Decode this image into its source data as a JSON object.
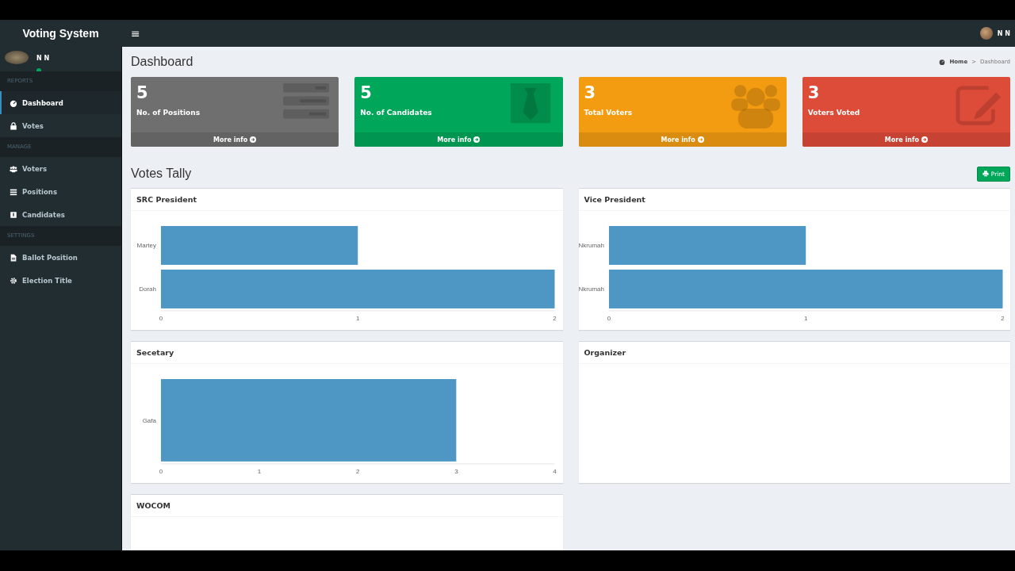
{
  "header": {
    "brand": "Voting System",
    "menu_glyph": "≡",
    "user": "N N"
  },
  "sidebar": {
    "user": "N N",
    "sections": [
      {
        "header": "REPORTS",
        "items": [
          {
            "label": "Dashboard",
            "kind": "dashboard",
            "selected": true
          },
          {
            "label": "Votes",
            "kind": "lock",
            "selected": false
          }
        ]
      },
      {
        "header": "MANAGE",
        "items": [
          {
            "label": "Voters",
            "kind": "users",
            "selected": false
          },
          {
            "label": "Positions",
            "kind": "list",
            "selected": false
          },
          {
            "label": "Candidates",
            "kind": "card",
            "selected": false
          }
        ]
      },
      {
        "header": "SETTINGS",
        "items": [
          {
            "label": "Ballot Position",
            "kind": "file",
            "selected": false
          },
          {
            "label": "Election Title",
            "kind": "gear",
            "selected": false
          }
        ]
      }
    ]
  },
  "page": {
    "title": "Dashboard",
    "breadcrumb": [
      "Home",
      "Dashboard"
    ],
    "breadcrumb_separator": ">"
  },
  "stat_cards": [
    {
      "value": "5",
      "label": "No. of Positions",
      "link": "More info",
      "kind": "positions",
      "color": "#6f6f6f"
    },
    {
      "value": "5",
      "label": "No. of Candidates",
      "link": "More info",
      "kind": "tie",
      "color": "#00a65a"
    },
    {
      "value": "3",
      "label": "Total Voters",
      "link": "More info",
      "kind": "users",
      "color": "#f39c12"
    },
    {
      "value": "3",
      "label": "Voters Voted",
      "link": "More info",
      "kind": "edit",
      "color": "#dd4b39"
    }
  ],
  "tally": {
    "title": "Votes Tally",
    "print_button": "Print",
    "panels": [
      {
        "title": "SRC President",
        "chart_data": {
          "type": "bar",
          "orientation": "horizontal",
          "categories": [
            "Martey",
            "Dorah"
          ],
          "values": [
            1,
            2
          ],
          "xlim": [
            0,
            2
          ],
          "xticks": [
            0,
            1,
            2
          ]
        }
      },
      {
        "title": "Vice President",
        "chart_data": {
          "type": "bar",
          "orientation": "horizontal",
          "categories": [
            "Nkrumah",
            "Nkrumah"
          ],
          "values": [
            1,
            2
          ],
          "xlim": [
            0,
            2
          ],
          "xticks": [
            0,
            1,
            2
          ]
        }
      },
      {
        "title": "Secetary",
        "chart_data": {
          "type": "bar",
          "orientation": "horizontal",
          "categories": [
            "Gafa"
          ],
          "values": [
            3
          ],
          "xlim": [
            0,
            4
          ],
          "xticks": [
            0,
            1,
            2,
            3,
            4
          ]
        }
      },
      {
        "title": "Organizer"
      },
      {
        "title": "WOCOM"
      }
    ]
  }
}
